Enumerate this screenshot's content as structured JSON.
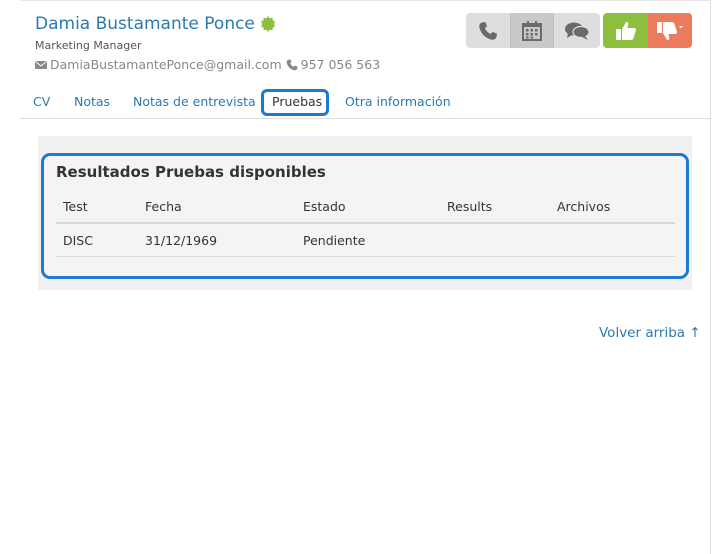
{
  "candidate": {
    "name": "Damia Bustamante Ponce",
    "job_title": "Marketing Manager",
    "email": "DamiaBustamantePonce@gmail.com",
    "phone": "957 056 563",
    "verified_icon": "verified-badge-icon"
  },
  "actions": {
    "call_icon": "phone-icon",
    "calendar_icon": "calendar-icon",
    "chat_icon": "chat-icon",
    "like_icon": "thumbs-up-icon",
    "dislike_icon": "thumbs-down-icon",
    "colors": {
      "like": "#8dbe3e",
      "dislike": "#ec7b5e",
      "neutral": "#dedede"
    }
  },
  "tabs": [
    {
      "label": "CV"
    },
    {
      "label": "Notas"
    },
    {
      "label": "Notas de entrevista"
    },
    {
      "label": "Pruebas",
      "active": true
    },
    {
      "label": "Otra información"
    }
  ],
  "results": {
    "title": "Resultados Pruebas disponibles",
    "columns": [
      "Test",
      "Fecha",
      "Estado",
      "Results",
      "Archivos"
    ],
    "rows": [
      [
        "DISC",
        "31/12/1969",
        "Pendiente",
        "",
        ""
      ]
    ]
  },
  "footer": {
    "back_to_top": "Volver arriba ↑"
  },
  "colors": {
    "accent": "#2a7ab0",
    "highlight": "#1e78d6"
  }
}
